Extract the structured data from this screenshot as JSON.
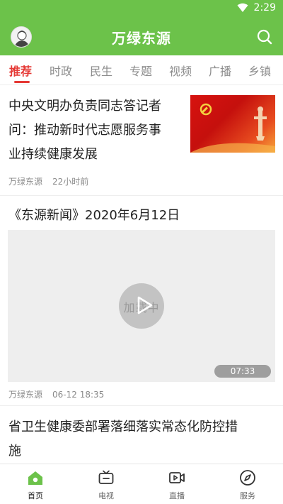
{
  "status_bar": {
    "time": "2:29"
  },
  "header": {
    "title": "万绿东源",
    "avatar_icon": "user-avatar-icon",
    "search_icon": "search-icon"
  },
  "tabs": [
    {
      "label": "推荐",
      "active": true
    },
    {
      "label": "时政"
    },
    {
      "label": "民生"
    },
    {
      "label": "专题"
    },
    {
      "label": "视频"
    },
    {
      "label": "广播"
    },
    {
      "label": "乡镇"
    }
  ],
  "feed": {
    "article1": {
      "title_lines": [
        "中央文明办负责同志答记者",
        "问：推动新时代志愿服务事",
        "业持续健康发展"
      ],
      "source": "万绿东源",
      "time": "22小时前"
    },
    "article2": {
      "title": "《东源新闻》2020年6月12日",
      "loading_text": "加载中",
      "duration": "07:33",
      "source": "万绿东源",
      "time": "06-12 18:35"
    },
    "article3": {
      "title_lines": [
        "省卫生健康委部署落细落实常态化防控措",
        "施"
      ]
    }
  },
  "bottom_nav": [
    {
      "label": "首页",
      "icon": "home-icon",
      "active": true
    },
    {
      "label": "电视",
      "icon": "tv-icon"
    },
    {
      "label": "直播",
      "icon": "live-video-icon"
    },
    {
      "label": "服务",
      "icon": "compass-icon"
    }
  ],
  "colors": {
    "brand_green": "#6cc24a",
    "active_tab": "#e53935"
  }
}
